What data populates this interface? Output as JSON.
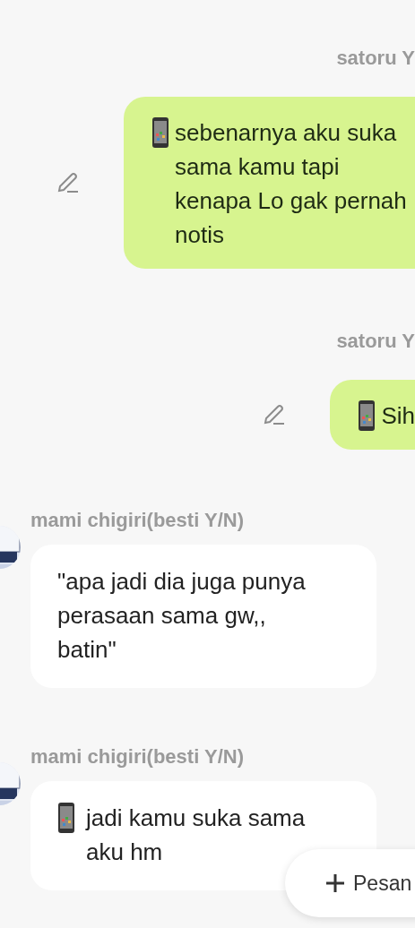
{
  "messages": [
    {
      "kind": "outgoing",
      "sender": "satoru Y",
      "phone_icon": true,
      "text": "sebenarnya aku suka sama kamu tapi kenapa Lo gak pernah notis"
    },
    {
      "kind": "outgoing",
      "sender": "satoru Y",
      "phone_icon": true,
      "text": "Sih"
    },
    {
      "kind": "incoming",
      "sender": "mami chigiri(besti Y/N)",
      "phone_icon": false,
      "text": "\"apa jadi dia juga punya perasaan sama gw,, batin\""
    },
    {
      "kind": "incoming",
      "sender": "mami chigiri(besti Y/N)",
      "phone_icon": true,
      "text": "jadi kamu suka sama aku hm"
    }
  ],
  "new_message_button": {
    "label": "Pesan"
  }
}
